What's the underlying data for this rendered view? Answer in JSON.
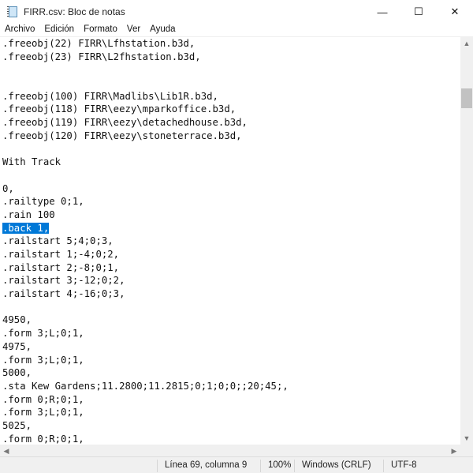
{
  "window": {
    "title": "FIRR.csv: Bloc de notas",
    "minimize": "—",
    "maximize": "☐",
    "close": "✕"
  },
  "menu": [
    "Archivo",
    "Edición",
    "Formato",
    "Ver",
    "Ayuda"
  ],
  "editor": {
    "lines": [
      ".freeobj(22) FIRR\\Lfhstation.b3d,",
      ".freeobj(23) FIRR\\L2fhstation.b3d,",
      "",
      "",
      ".freeobj(100) FIRR\\Madlibs\\Lib1R.b3d,",
      ".freeobj(118) FIRR\\eezy\\mparkoffice.b3d,",
      ".freeobj(119) FIRR\\eezy\\detachedhouse.b3d,",
      ".freeobj(120) FIRR\\eezy\\stoneterrace.b3d,",
      "",
      "With Track",
      "",
      "0,",
      ".railtype 0;1,",
      ".rain 100",
      ".back 1,",
      ".railstart 5;4;0;3,",
      ".railstart 1;-4;0;2,",
      ".railstart 2;-8;0;1,",
      ".railstart 3;-12;0;2,",
      ".railstart 4;-16;0;3,",
      "",
      "4950,",
      ".form 3;L;0;1,",
      "4975,",
      ".form 3;L;0;1,",
      "5000,",
      ".sta Kew Gardens;11.2800;11.2815;0;1;0;0;;20;45;,",
      ".form 0;R;0;1,",
      ".form 3;L;0;1,",
      "5025,",
      ".form 0;R;0;1,"
    ],
    "selected_line_index": 14,
    "selection_color": "#0078d7"
  },
  "status": {
    "position": "Línea 69, columna 9",
    "zoom": "100%",
    "line_ending": "Windows (CRLF)",
    "encoding": "UTF-8"
  }
}
